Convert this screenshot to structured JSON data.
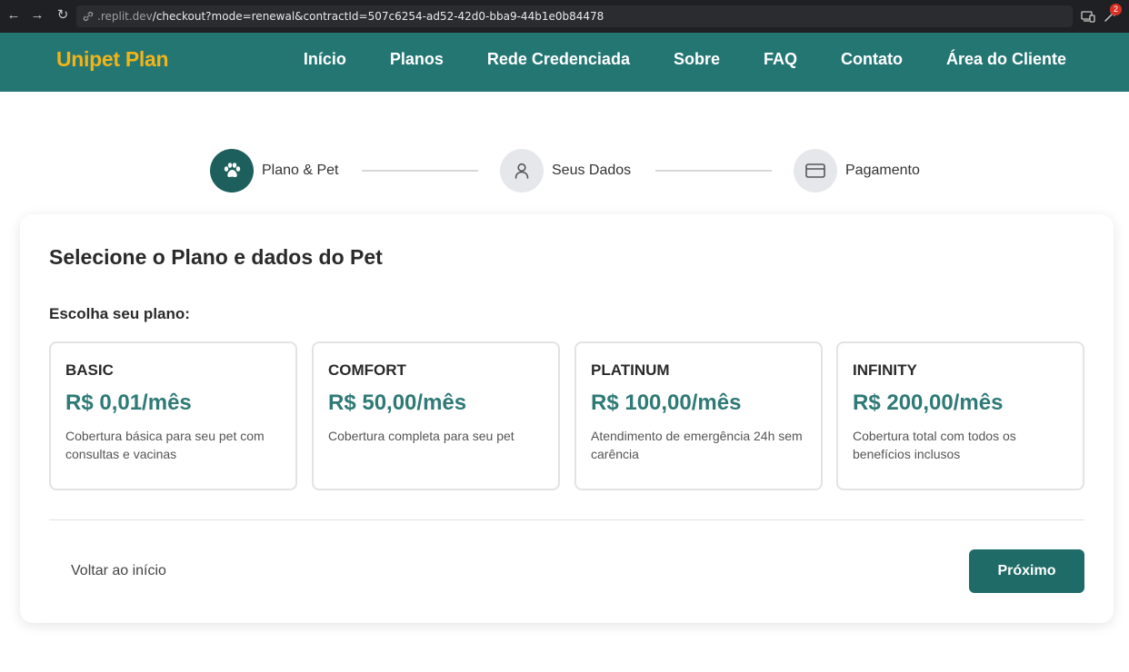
{
  "browser": {
    "url_host": ".replit.dev",
    "url_path": "/checkout?mode=renewal&contractId=507c6254-ad52-42d0-bba9-44b1e0b84478",
    "badge_count": "2",
    "icons": [
      "back-arrow-icon",
      "forward-arrow-icon",
      "reload-icon",
      "link-icon",
      "devices-icon",
      "extension-icon"
    ]
  },
  "header": {
    "logo": "Unipet Plan",
    "menu": [
      "Início",
      "Planos",
      "Rede Credenciada",
      "Sobre",
      "FAQ",
      "Contato",
      "Área do Cliente"
    ]
  },
  "stepper": {
    "steps": [
      {
        "label": "Plano & Pet",
        "icon": "paw-icon",
        "active": true
      },
      {
        "label": "Seus Dados",
        "icon": "user-icon",
        "active": false
      },
      {
        "label": "Pagamento",
        "icon": "credit-card-icon",
        "active": false
      }
    ]
  },
  "card": {
    "title": "Selecione o Plano e dados do Pet",
    "plan_prompt": "Escolha seu plano:",
    "plans": [
      {
        "name": "BASIC",
        "price": "R$ 0,01/mês",
        "description": "Cobertura básica para seu pet com consultas e vacinas"
      },
      {
        "name": "COMFORT",
        "price": "R$ 50,00/mês",
        "description": "Cobertura completa para seu pet"
      },
      {
        "name": "PLATINUM",
        "price": "R$ 100,00/mês",
        "description": "Atendimento de emergência 24h sem carência"
      },
      {
        "name": "INFINITY",
        "price": "R$ 200,00/mês",
        "description": "Cobertura total com todos os benefícios inclusos"
      }
    ],
    "back_label": "Voltar ao início",
    "next_label": "Próximo"
  },
  "colors": {
    "header_bg": "#247673",
    "logo": "#f2b418",
    "accent": "#1f6b67",
    "price": "#2e7a76"
  }
}
